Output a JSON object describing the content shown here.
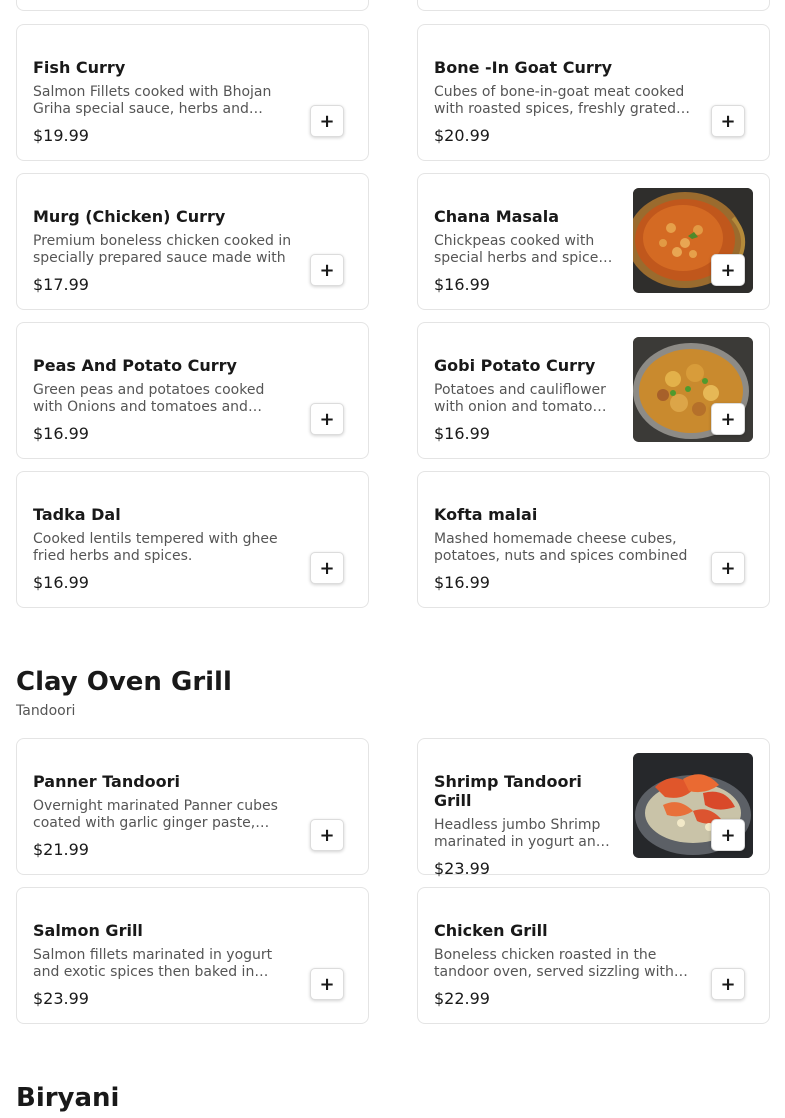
{
  "sections": [
    {
      "items": [
        {
          "name": "Fish Curry",
          "desc": "Salmon Fillets cooked with Bhojan Griha special sauce, herbs and spices.",
          "price": "$19.99"
        },
        {
          "name": "Bone -In Goat Curry",
          "desc": "Cubes of bone-in-goat meat cooked with roasted spices, freshly grated ginger and garlic.",
          "price": "$20.99"
        },
        {
          "name": "Murg (Chicken) Curry",
          "desc": "Premium boneless chicken cooked in specially prepared sauce made with",
          "price": "$17.99"
        },
        {
          "name": "Chana Masala",
          "desc": "Chickpeas cooked with special herbs and spices in tomato sauce.",
          "price": "$16.99"
        },
        {
          "name": "Peas And Potato Curry",
          "desc": "Green peas and potatoes cooked with Onions and tomatoes and spices.",
          "price": "$16.99"
        },
        {
          "name": "Gobi Potato Curry",
          "desc": "Potatoes and cauliflower with onion and tomato sauce.",
          "price": "$16.99"
        },
        {
          "name": "Tadka Dal",
          "desc": "Cooked lentils tempered with ghee fried herbs and spices.",
          "price": "$16.99"
        },
        {
          "name": "Kofta malai",
          "desc": "Mashed homemade cheese cubes, potatoes, nuts and spices combined",
          "price": "$16.99"
        }
      ]
    },
    {
      "title": "Clay Oven Grill",
      "subtitle": "Tandoori",
      "items": [
        {
          "name": "Panner Tandoori",
          "desc": "Overnight marinated Panner cubes coated with garlic ginger paste, yogurt and spices.",
          "price": "$21.99"
        },
        {
          "name": "Shrimp Tandoori Grill",
          "desc": "Headless jumbo Shrimp marinated in yogurt and spices.",
          "price": "$23.99"
        },
        {
          "name": "Salmon Grill",
          "desc": "Salmon fillets marinated in yogurt and exotic spices then baked in tandoor.",
          "price": "$23.99"
        },
        {
          "name": "Chicken Grill",
          "desc": "Boneless chicken roasted in the tandoor oven, served sizzling with onions.",
          "price": "$22.99"
        }
      ]
    },
    {
      "title": "Biryani"
    }
  ],
  "add_label": "+",
  "icons": {
    "add": "plus-icon"
  }
}
